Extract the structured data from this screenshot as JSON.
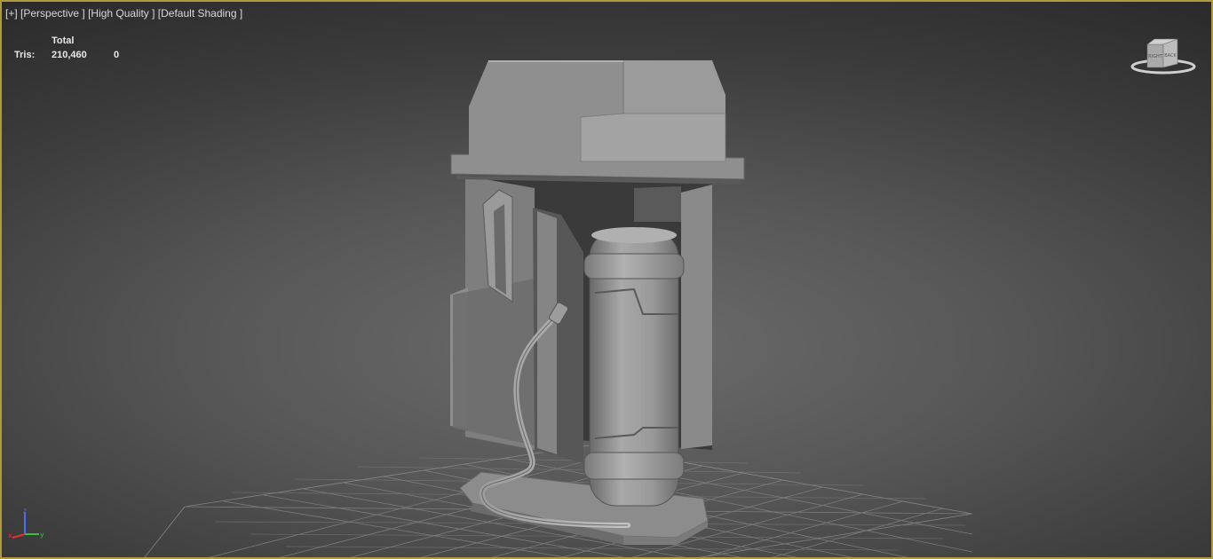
{
  "viewport": {
    "menu_label": "[+]",
    "view_label": "[Perspective ]",
    "quality_label": "[High Quality ]",
    "shading_label": "[Default Shading ]",
    "border_color": "#b19a3e"
  },
  "stats": {
    "header": "Total",
    "tris_label": "Tris:",
    "tris_value": "210,460",
    "tris_selected": "0"
  },
  "viewcube": {
    "face_left": "RIGHT",
    "face_right": "BACK"
  },
  "axis": {
    "x": "x",
    "y": "y",
    "z": "z"
  },
  "colors": {
    "background_center": "#6c6c6c",
    "background_edge": "#2a2a2a",
    "grid": "#8a8a8a",
    "model": "#9a9a9a"
  }
}
